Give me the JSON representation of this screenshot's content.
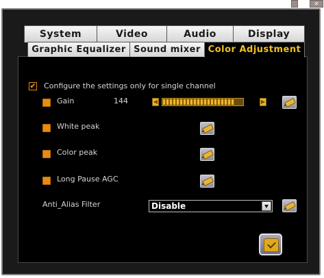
{
  "tabs_row_back": [
    {
      "label": "System"
    },
    {
      "label": "Video"
    },
    {
      "label": "Audio"
    },
    {
      "label": "Display"
    }
  ],
  "tabs_row_front": [
    {
      "label": "Graphic Equalizer"
    },
    {
      "label": "Sound mixer"
    },
    {
      "label": "Color Adjustment",
      "active": true
    }
  ],
  "panel": {
    "single_channel_label": "Configure the settings only for single channel",
    "single_channel_checked": true,
    "gain": {
      "label": "Gain",
      "value": "144",
      "slider_fraction": 0.9
    },
    "white_peak": {
      "label": "White peak"
    },
    "color_peak": {
      "label": "Color peak"
    },
    "long_pause_agc": {
      "label": "Long Pause AGC"
    },
    "anti_alias": {
      "label": "Anti_Alias Filter",
      "selected": "Disable"
    }
  },
  "colors": {
    "accent": "#e88b10",
    "active_tab_text": "#f0c020",
    "panel_bg": "#000000"
  },
  "icons": {
    "apply": "pencil-icon",
    "ok": "checkmark-icon",
    "slider_left": "arrow-left-icon",
    "slider_right": "arrow-right-icon"
  }
}
